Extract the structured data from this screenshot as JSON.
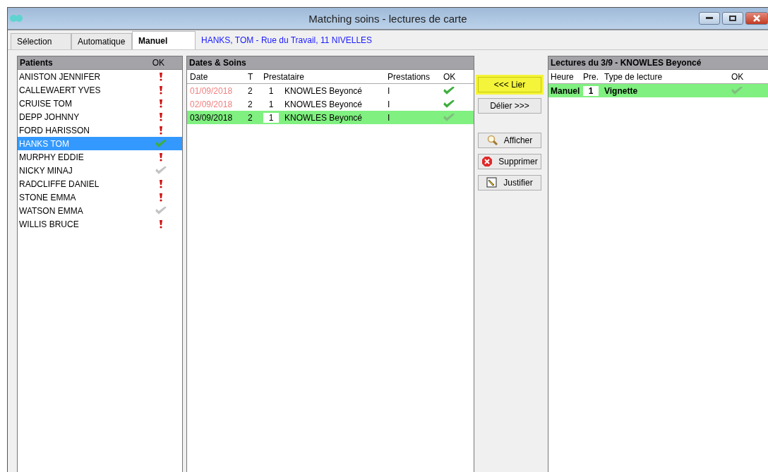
{
  "window": {
    "title": "Matching soins - lectures de carte"
  },
  "tabs": [
    {
      "label": "Sélection",
      "selected": false
    },
    {
      "label": "Automatique",
      "selected": false
    },
    {
      "label": "Manuel",
      "selected": true
    }
  ],
  "patient_info": "HANKS, TOM - Rue du Travail, 11 NIVELLES",
  "patients": {
    "title": "Patients",
    "ok_header": "OK",
    "items": [
      {
        "name": "ANISTON JENNIFER",
        "kind": "alert",
        "selected": false
      },
      {
        "name": "CALLEWAERT YVES",
        "kind": "alert",
        "selected": false
      },
      {
        "name": "CRUISE TOM",
        "kind": "alert",
        "selected": false
      },
      {
        "name": "DEPP JOHNNY",
        "kind": "alert",
        "selected": false
      },
      {
        "name": "FORD HARISSON",
        "kind": "alert",
        "selected": false
      },
      {
        "name": "HANKS TOM",
        "kind": "ok",
        "selected": true
      },
      {
        "name": "MURPHY EDDIE",
        "kind": "alert",
        "selected": false
      },
      {
        "name": "NICKY  MINAJ",
        "kind": "partial",
        "selected": false
      },
      {
        "name": "RADCLIFFE DANIEL",
        "kind": "alert",
        "selected": false
      },
      {
        "name": "STONE EMMA",
        "kind": "alert",
        "selected": false
      },
      {
        "name": "WATSON EMMA",
        "kind": "partial",
        "selected": false
      },
      {
        "name": "WILLIS BRUCE",
        "kind": "alert",
        "selected": false
      }
    ]
  },
  "soins": {
    "title": "Dates & Soins",
    "columns": [
      "Date",
      "T",
      "Prestataire",
      "Prestations",
      "OK"
    ],
    "rows": [
      {
        "date": "01/09/2018",
        "t": "2",
        "num": "1",
        "prestataire": "KNOWLES Beyoncé",
        "prestations": "I",
        "kind": "ok",
        "flagged": true,
        "selected": false
      },
      {
        "date": "02/09/2018",
        "t": "2",
        "num": "1",
        "prestataire": "KNOWLES Beyoncé",
        "prestations": "I",
        "kind": "ok",
        "flagged": true,
        "selected": false
      },
      {
        "date": "03/09/2018",
        "t": "2",
        "num": "1",
        "prestataire": "KNOWLES Beyoncé",
        "prestations": "I",
        "kind": "linked",
        "flagged": false,
        "selected": true
      }
    ]
  },
  "buttons": [
    {
      "label": "<<< Lier",
      "kind": "plain",
      "highlighted": true
    },
    {
      "label": "Délier >>>",
      "kind": "plain",
      "highlighted": false
    },
    {
      "label": "Afficher",
      "kind": "magnifier",
      "highlighted": false
    },
    {
      "label": "Supprimer",
      "kind": "delete",
      "highlighted": false
    },
    {
      "label": "Justifier",
      "kind": "pencil",
      "highlighted": false
    }
  ],
  "lectures": {
    "title": "Lectures du 3/9 - KNOWLES Beyoncé",
    "columns": [
      "Heure",
      "Pre.",
      "Type de lecture",
      "OK"
    ],
    "rows": [
      {
        "heure": "Manuel",
        "pre": "1",
        "type": "Vignette",
        "kind": "linked",
        "selected": true
      }
    ]
  }
}
